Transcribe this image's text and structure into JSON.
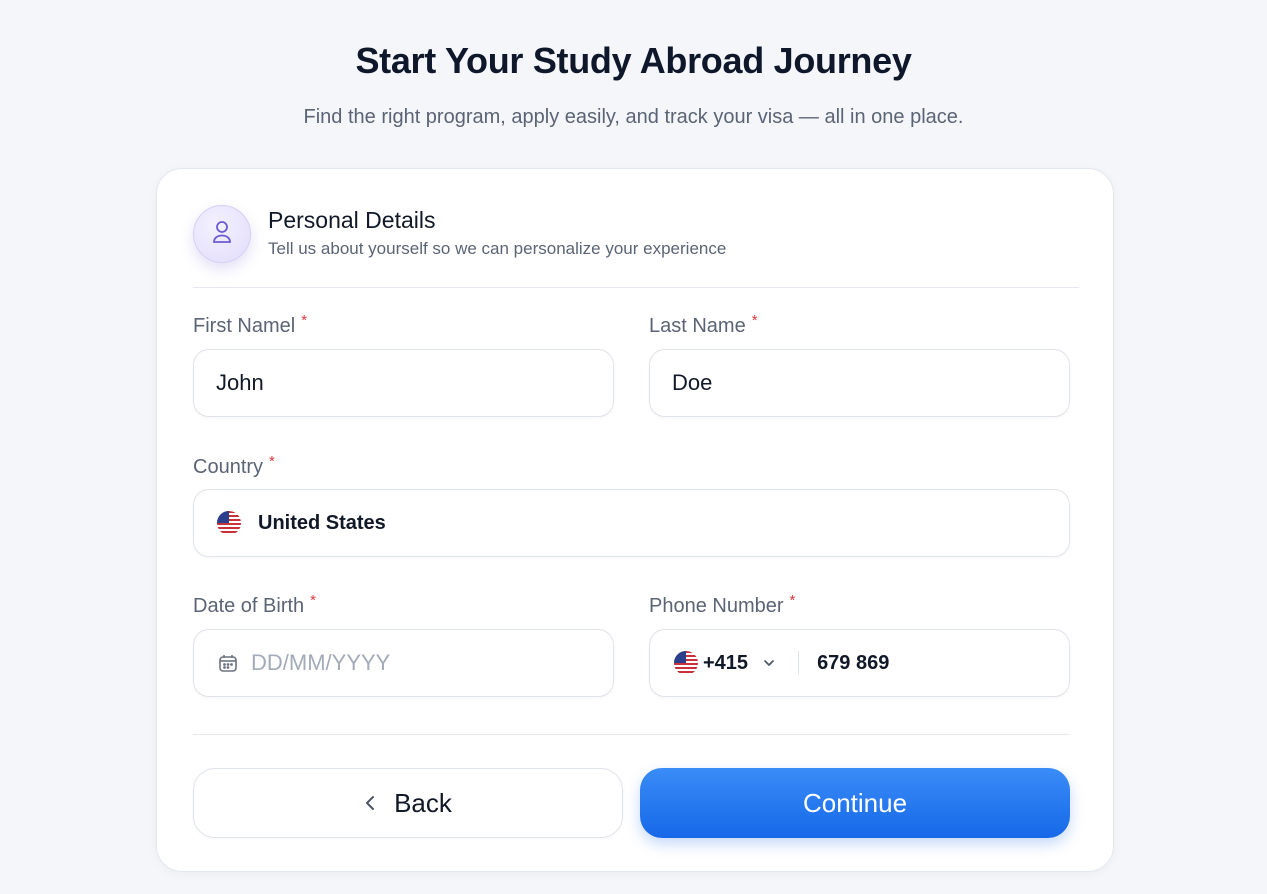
{
  "header": {
    "title": "Start Your Study Abroad Journey",
    "subtitle": "Find the right program, apply easily, and track your visa — all in one place."
  },
  "section": {
    "icon": "user-icon",
    "title": "Personal Details",
    "description": "Tell us about yourself so we can personalize your experience"
  },
  "form": {
    "required_mark": "*",
    "first_name": {
      "label": "First Namel",
      "value": "John"
    },
    "last_name": {
      "label": "Last Name",
      "value": "Doe"
    },
    "country": {
      "label": "Country",
      "value": "United States",
      "flag": "us-flag-icon"
    },
    "dob": {
      "label": "Date of Birth",
      "placeholder": "DD/MM/YYYY",
      "icon": "calendar-icon"
    },
    "phone": {
      "label": "Phone Number",
      "code": "+415",
      "number": "679 869",
      "flag": "us-flag-icon"
    }
  },
  "actions": {
    "back_label": "Back",
    "continue_label": "Continue"
  },
  "colors": {
    "primary": "#1668e8",
    "required": "#e0383e",
    "avatar_accent": "#6d5bd0"
  }
}
